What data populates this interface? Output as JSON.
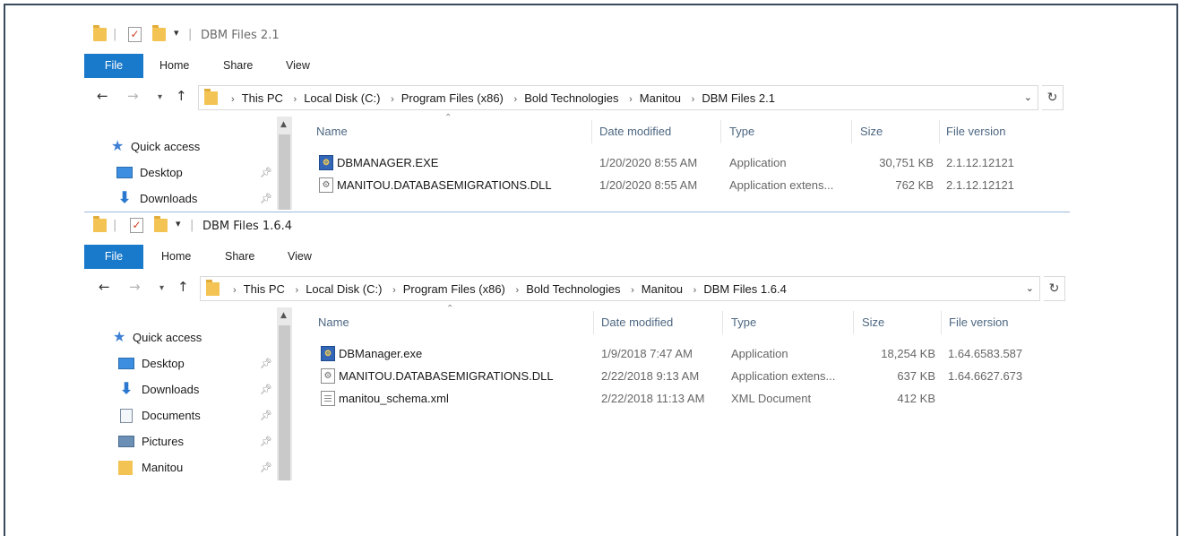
{
  "windows": [
    {
      "title": "DBM Files 2.1",
      "ribbon_tabs": [
        "File",
        "Home",
        "Share",
        "View"
      ],
      "breadcrumbs": [
        "This PC",
        "Local Disk (C:)",
        "Program Files (x86)",
        "Bold Technologies",
        "Manitou",
        "DBM Files 2.1"
      ],
      "nav_items": [
        {
          "label": "Quick access",
          "icon": "star-icon"
        },
        {
          "label": "Desktop",
          "icon": "desktop-icon",
          "pinned": true
        },
        {
          "label": "Downloads",
          "icon": "download-icon",
          "pinned": true
        }
      ],
      "columns": [
        "Name",
        "Date modified",
        "Type",
        "Size",
        "File version"
      ],
      "files": [
        {
          "name": "DBMANAGER.EXE",
          "date": "1/20/2020 8:55 AM",
          "type": "Application",
          "size": "30,751 KB",
          "version": "2.1.12.12121",
          "icon": "exe-icon"
        },
        {
          "name": "MANITOU.DATABASEMIGRATIONS.DLL",
          "date": "1/20/2020 8:55 AM",
          "type": "Application extens...",
          "size": "762 KB",
          "version": "2.1.12.12121",
          "icon": "dll-icon"
        }
      ]
    },
    {
      "title": "DBM Files 1.6.4",
      "ribbon_tabs": [
        "File",
        "Home",
        "Share",
        "View"
      ],
      "breadcrumbs": [
        "This PC",
        "Local Disk (C:)",
        "Program Files (x86)",
        "Bold Technologies",
        "Manitou",
        "DBM Files 1.6.4"
      ],
      "nav_items": [
        {
          "label": "Quick access",
          "icon": "star-icon"
        },
        {
          "label": "Desktop",
          "icon": "desktop-icon",
          "pinned": true
        },
        {
          "label": "Downloads",
          "icon": "download-icon",
          "pinned": true
        },
        {
          "label": "Documents",
          "icon": "documents-icon",
          "pinned": true
        },
        {
          "label": "Pictures",
          "icon": "pictures-icon",
          "pinned": true
        },
        {
          "label": "Manitou",
          "icon": "folder-icon",
          "pinned": true
        }
      ],
      "columns": [
        "Name",
        "Date modified",
        "Type",
        "Size",
        "File version"
      ],
      "files": [
        {
          "name": "DBManager.exe",
          "date": "1/9/2018 7:47 AM",
          "type": "Application",
          "size": "18,254 KB",
          "version": "1.64.6583.587",
          "icon": "exe-icon"
        },
        {
          "name": "MANITOU.DATABASEMIGRATIONS.DLL",
          "date": "2/22/2018 9:13 AM",
          "type": "Application extens...",
          "size": "637 KB",
          "version": "1.64.6627.673",
          "icon": "dll-icon"
        },
        {
          "name": "manitou_schema.xml",
          "date": "2/22/2018 11:13 AM",
          "type": "XML Document",
          "size": "412 KB",
          "version": "",
          "icon": "xml-icon"
        }
      ]
    }
  ],
  "colors": {
    "file_tab": "#1979ca",
    "column_header_text": "#4d6782",
    "folder": "#f3c453"
  }
}
